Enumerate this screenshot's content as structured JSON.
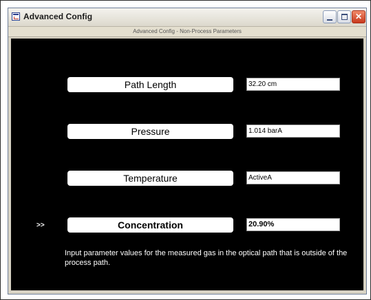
{
  "window": {
    "title": "Advanced Config",
    "controls": [
      "minimize",
      "maximize",
      "close"
    ]
  },
  "subheader": {
    "text": "Advanced Config - Non-Process Parameters"
  },
  "icons": {
    "app": "app-icon",
    "minimize": "minimize-icon",
    "maximize": "maximize-icon",
    "close": "close-icon"
  },
  "colors": {
    "panel_background": "#000000",
    "title_bar": "#ece9d8",
    "close_button": "#c8391d",
    "label_background": "#ffffff"
  },
  "parameters": [
    {
      "label": "Path Length",
      "value": "32.20 cm",
      "selected": false
    },
    {
      "label": "Pressure",
      "value": "1.014 barA",
      "selected": false
    },
    {
      "label": "Temperature",
      "value": "ActiveA",
      "selected": false
    },
    {
      "label": "Concentration",
      "value": "20.90%",
      "selected": true
    }
  ],
  "selection_marker": ">>",
  "help_text": "Input parameter values for the measured gas in the optical path that is outside of the process path."
}
